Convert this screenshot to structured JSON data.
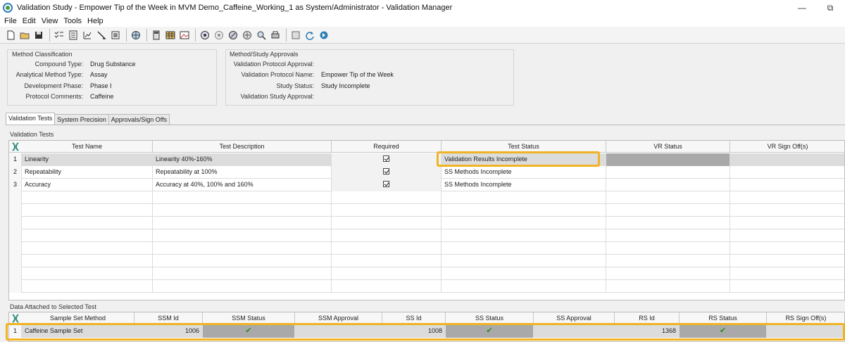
{
  "window": {
    "title": "Validation Study - Empower Tip of the Week in MVM Demo_Caffeine_Working_1 as System/Administrator - Validation Manager",
    "minimize": "—",
    "maximize": "⧉"
  },
  "menu": [
    "File",
    "Edit",
    "View",
    "Tools",
    "Help"
  ],
  "toolbar_icons": [
    "new-icon",
    "open-icon",
    "save-icon",
    "checklist-icon",
    "report-icon",
    "chart-icon",
    "sign-icon",
    "doc-icon",
    "globe-icon",
    "calc-icon",
    "table-icon",
    "image-icon",
    "target-icon",
    "target2-icon",
    "disk-icon",
    "search-icon",
    "grid-icon",
    "refresh-icon",
    "next-icon"
  ],
  "method_classification": {
    "title": "Method Classification",
    "fields": [
      {
        "label": "Compound Type:",
        "value": "Drug Substance"
      },
      {
        "label": "Analytical Method Type:",
        "value": "Assay"
      },
      {
        "label": "Development Phase:",
        "value": "Phase I"
      },
      {
        "label": "Protocol Comments:",
        "value": "Caffeine"
      }
    ]
  },
  "approvals": {
    "title": "Method/Study Approvals",
    "fields": [
      {
        "label": "Validation Protocol Approval:",
        "value": ""
      },
      {
        "label": "Validation Protocol Name:",
        "value": "Empower Tip of the Week"
      },
      {
        "label": "Study Status:",
        "value": "Study Incomplete"
      },
      {
        "label": "Validation Study Approval:",
        "value": ""
      }
    ]
  },
  "tabs": [
    "Validation Tests",
    "System Precision",
    "Approvals/Sign Offs"
  ],
  "validation_tests": {
    "label": "Validation Tests",
    "columns": [
      "Test Name",
      "Test Description",
      "Required",
      "Test Status",
      "VR Status",
      "VR Sign Off(s)"
    ],
    "rows": [
      {
        "num": "1",
        "name": "Linearity",
        "desc": "Linearity 40%-160%",
        "required": true,
        "status": "Validation Results Incomplete",
        "vr_status": "",
        "vr_signoff": ""
      },
      {
        "num": "2",
        "name": "Repeatability",
        "desc": "Repeatability at 100%",
        "required": true,
        "status": "SS Methods Incomplete",
        "vr_status": "",
        "vr_signoff": ""
      },
      {
        "num": "3",
        "name": "Accuracy",
        "desc": "Accuracy at 40%, 100% and 160%",
        "required": true,
        "status": "SS Methods Incomplete",
        "vr_status": "",
        "vr_signoff": ""
      }
    ]
  },
  "attached_data": {
    "label": "Data Attached to Selected Test",
    "columns": [
      "Sample Set Method",
      "SSM Id",
      "SSM Status",
      "SSM Approval",
      "SS Id",
      "SS Status",
      "SS Approval",
      "RS Id",
      "RS Status",
      "RS Sign Off(s)"
    ],
    "rows": [
      {
        "num": "1",
        "method": "Caffeine Sample Set",
        "ssm_id": "1006",
        "ssm_status": "✔",
        "ssm_approval": "",
        "ss_id": "1008",
        "ss_status": "✔",
        "ss_approval": "",
        "rs_id": "1368",
        "rs_status": "✔",
        "rs_signoff": ""
      }
    ]
  },
  "colors": {
    "highlight": "#f0b323",
    "check_green": "#2e8b1e",
    "selected_grey": "#a9a9a9"
  }
}
